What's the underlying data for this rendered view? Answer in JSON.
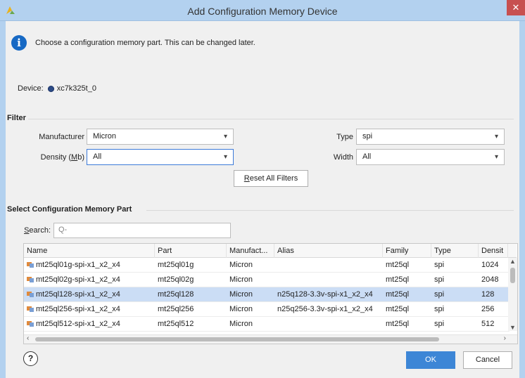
{
  "window": {
    "title": "Add Configuration Memory Device",
    "close_glyph": "✕"
  },
  "info": {
    "icon": "info-icon",
    "text": "Choose a configuration memory part. This can be changed later."
  },
  "device": {
    "label": "Device:",
    "value": "xc7k325t_0"
  },
  "filter": {
    "title": "Filter",
    "manufacturer": {
      "label": "Manufacturer",
      "value": "Micron"
    },
    "density": {
      "label_prefix": "Density (",
      "label_mnemonic": "M",
      "label_suffix": "b)",
      "value": "All"
    },
    "type": {
      "label": "Type",
      "value": "spi"
    },
    "width": {
      "label": "Width",
      "value": "All"
    },
    "reset": {
      "mnemonic": "R",
      "rest": "eset All Filters"
    }
  },
  "select_part": {
    "title": "Select Configuration Memory Part",
    "search": {
      "mnemonic": "S",
      "rest": "earch:",
      "placeholder": "Q-"
    },
    "columns": [
      "Name",
      "Part",
      "Manufact...",
      "Alias",
      "Family",
      "Type",
      "Densit"
    ],
    "rows": [
      {
        "name": "mt25ql01g-spi-x1_x2_x4",
        "part": "mt25ql01g",
        "manufacturer": "Micron",
        "alias": "",
        "family": "mt25ql",
        "type": "spi",
        "density": "1024"
      },
      {
        "name": "mt25ql02g-spi-x1_x2_x4",
        "part": "mt25ql02g",
        "manufacturer": "Micron",
        "alias": "",
        "family": "mt25ql",
        "type": "spi",
        "density": "2048"
      },
      {
        "name": "mt25ql128-spi-x1_x2_x4",
        "part": "mt25ql128",
        "manufacturer": "Micron",
        "alias": "n25q128-3.3v-spi-x1_x2_x4",
        "family": "mt25ql",
        "type": "spi",
        "density": "128"
      },
      {
        "name": "mt25ql256-spi-x1_x2_x4",
        "part": "mt25ql256",
        "manufacturer": "Micron",
        "alias": "n25q256-3.3v-spi-x1_x2_x4",
        "family": "mt25ql",
        "type": "spi",
        "density": "256"
      },
      {
        "name": "mt25ql512-spi-x1_x2_x4",
        "part": "mt25ql512",
        "manufacturer": "Micron",
        "alias": "",
        "family": "mt25ql",
        "type": "spi",
        "density": "512"
      }
    ],
    "selected_row": 2
  },
  "buttons": {
    "help": "?",
    "ok": "OK",
    "cancel": "Cancel"
  },
  "colors": {
    "accent": "#3d86d6",
    "selection": "#cbddf5",
    "titlebar": "#b3d1ef",
    "close": "#c75050"
  }
}
